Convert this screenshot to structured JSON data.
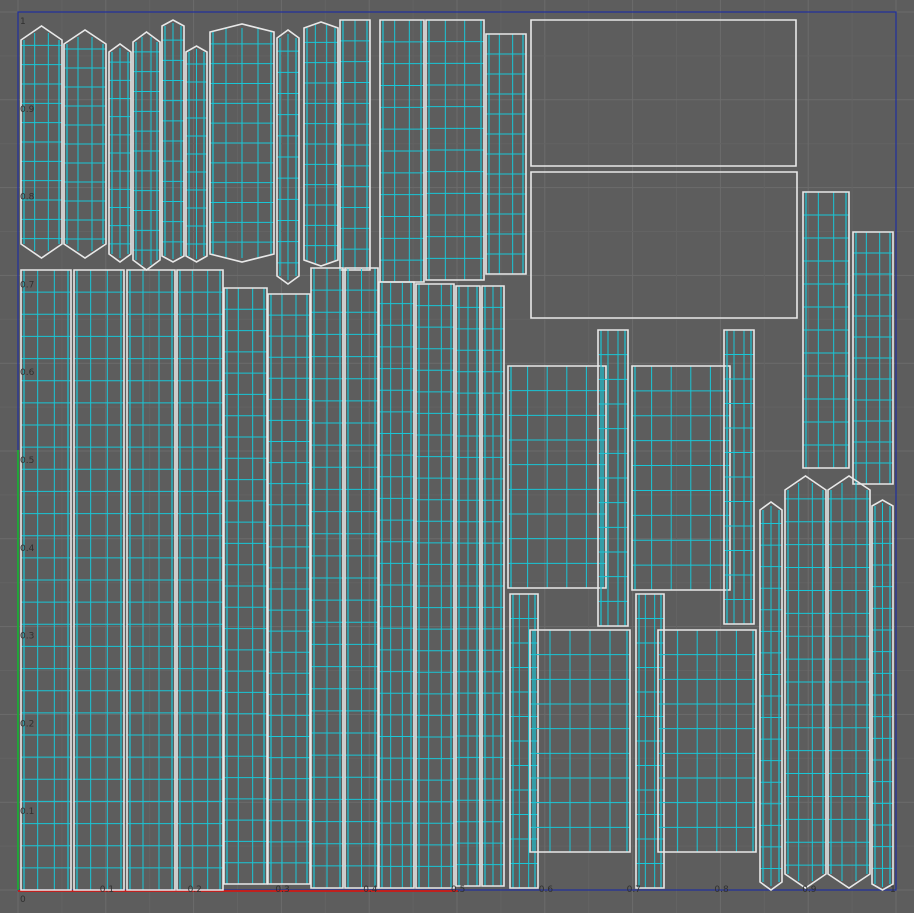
{
  "editor": {
    "title": "",
    "view": "uv-layout",
    "axis_labels": {
      "u": [
        "0.1",
        "0.2",
        "0.3",
        "0.4",
        "0.5",
        "0.6",
        "0.7",
        "0.8",
        "0.9",
        "1"
      ],
      "v": [
        "1",
        "0.9",
        "0.8",
        "0.7",
        "0.6",
        "0.5",
        "0.4",
        "0.3",
        "0.2",
        "0.1",
        "0"
      ]
    }
  },
  "colors": {
    "background": "#5d5d5d",
    "grid_major": "#6c6c6c",
    "grid_minor": "#636363",
    "uv_border": "#e8e8e8",
    "uv_wire": "#19c6d6",
    "axis_u": "#c0201e",
    "axis_v": "#22a33a",
    "frame": "#1f2f9f",
    "label": "#303030"
  },
  "icons": {
    "axis_u": "u-axis-icon",
    "axis_v": "v-axis-icon"
  }
}
